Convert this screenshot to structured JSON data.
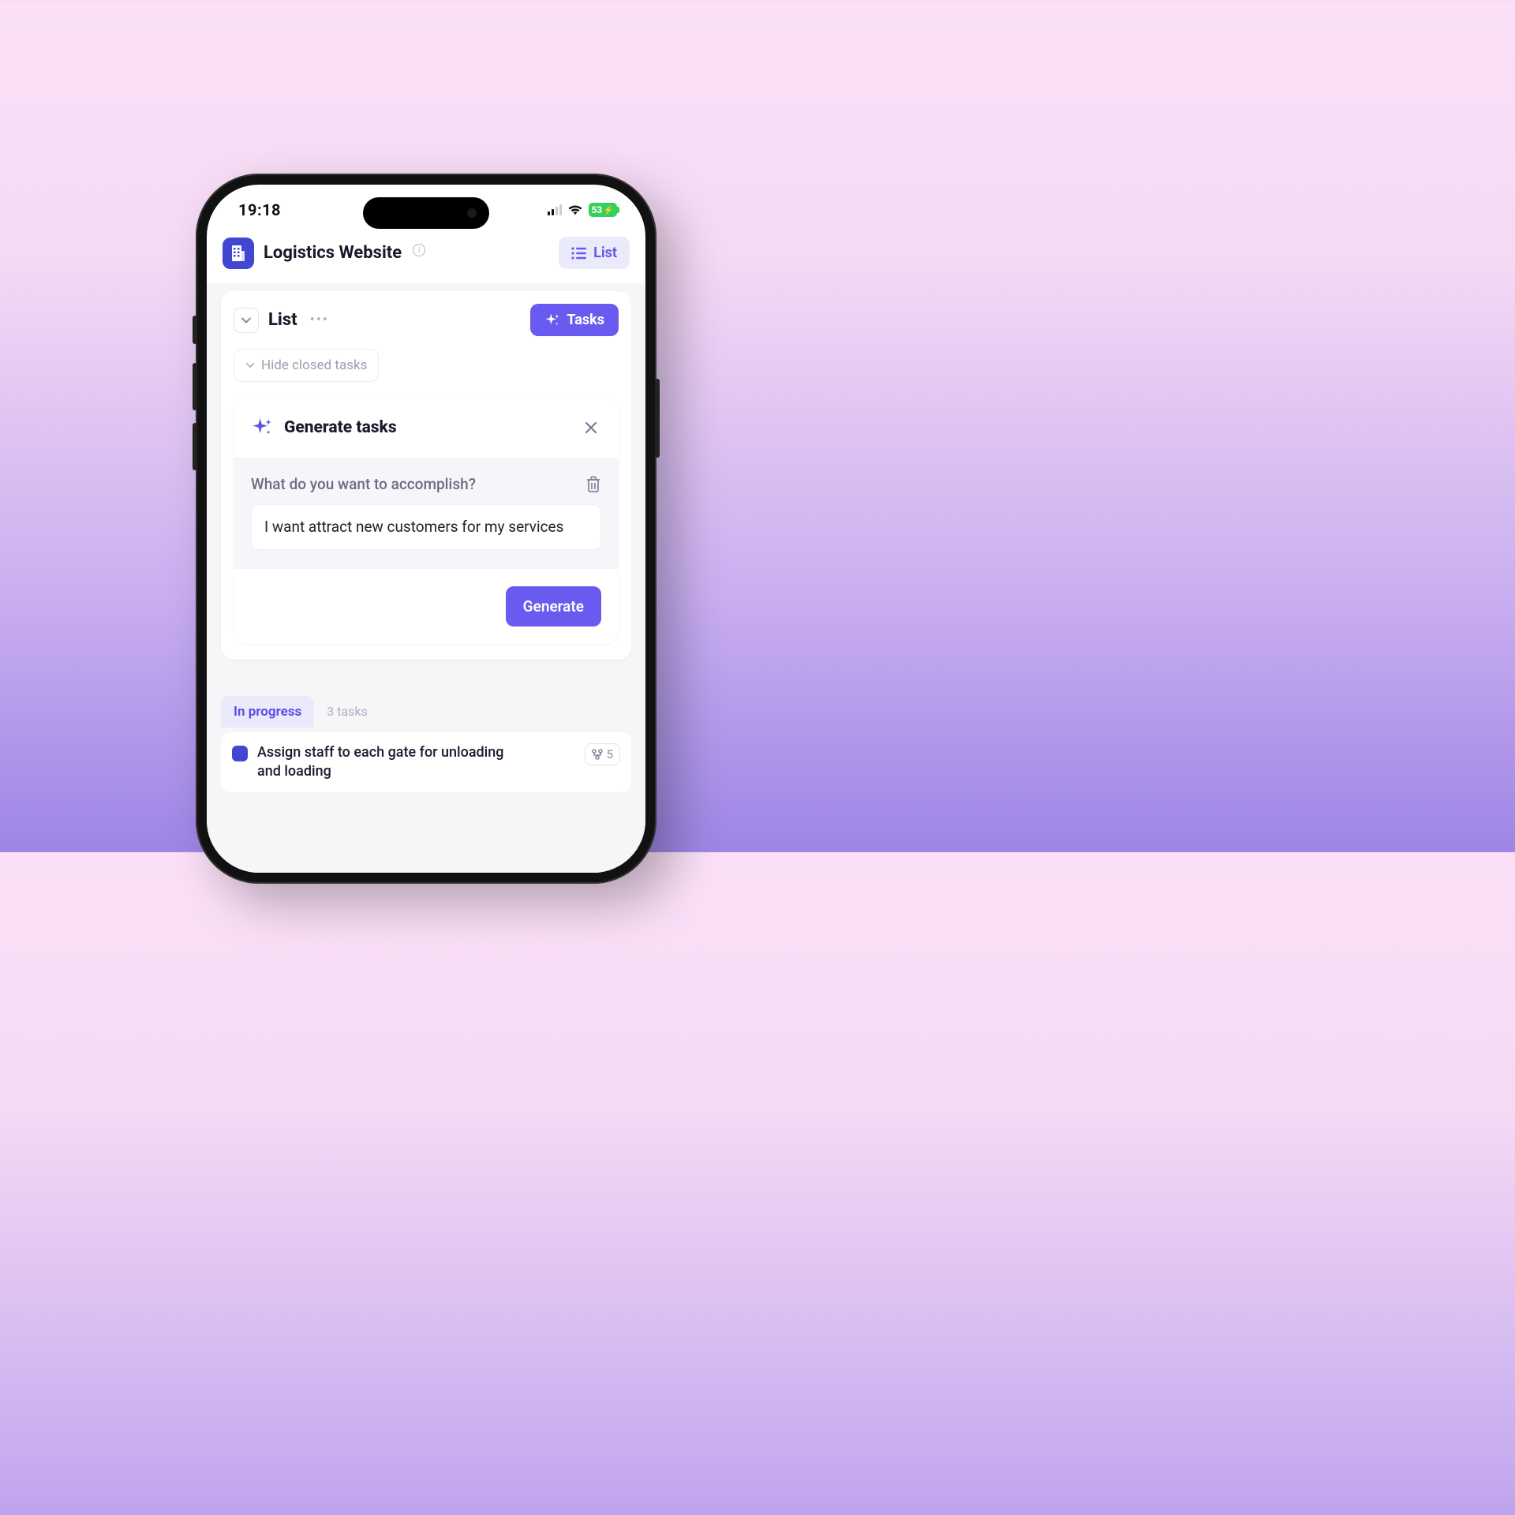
{
  "status_bar": {
    "time": "19:18",
    "battery_text": "53"
  },
  "header": {
    "project_title": "Logistics Website",
    "list_button_label": "List"
  },
  "list_card": {
    "title": "List",
    "hide_label": "Hide closed tasks",
    "tasks_button_label": "Tasks"
  },
  "generate_card": {
    "title": "Generate tasks",
    "question": "What do you want to accomplish?",
    "input_value": "I want attract new customers for my services",
    "generate_label": "Generate"
  },
  "section": {
    "active_tab": "In progress",
    "count_label": "3 tasks",
    "tasks": [
      {
        "title": "Assign staff to each gate for unloading and loading",
        "subtasks": "5"
      }
    ]
  }
}
